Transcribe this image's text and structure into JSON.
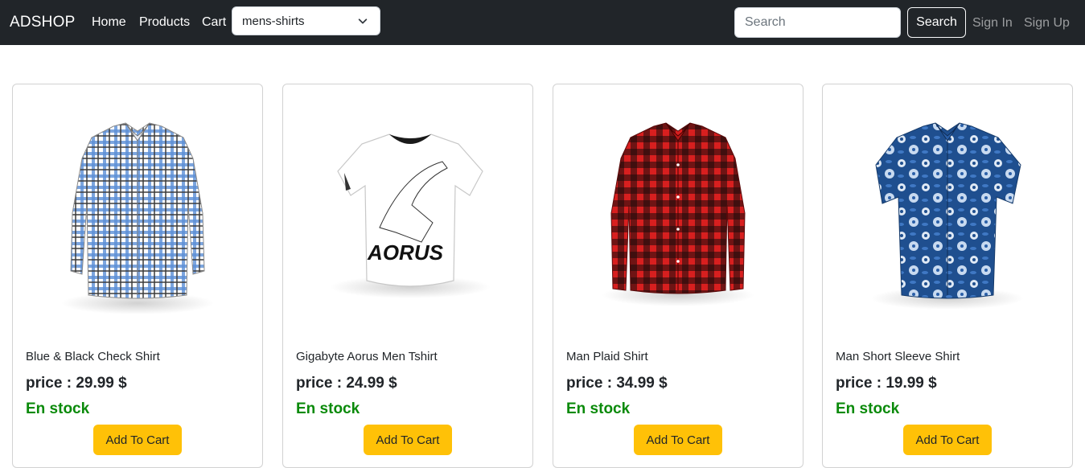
{
  "brand": "ADSHOP",
  "nav": {
    "home": "Home",
    "products": "Products",
    "cart": "Cart"
  },
  "category_select": {
    "value": "mens-shirts"
  },
  "search": {
    "placeholder": "Search",
    "button": "Search"
  },
  "auth": {
    "sign_in": "Sign In",
    "sign_up": "Sign Up"
  },
  "products": [
    {
      "title": "Blue & Black Check Shirt",
      "price_label": "price :",
      "price": "29.99",
      "currency": "$",
      "stock": "En stock",
      "button": "Add To Cart"
    },
    {
      "title": "Gigabyte Aorus Men Tshirt",
      "price_label": "price :",
      "price": "24.99",
      "currency": "$",
      "stock": "En stock",
      "button": "Add To Cart"
    },
    {
      "title": "Man Plaid Shirt",
      "price_label": "price :",
      "price": "34.99",
      "currency": "$",
      "stock": "En stock",
      "button": "Add To Cart"
    },
    {
      "title": "Man Short Sleeve Shirt",
      "price_label": "price :",
      "price": "19.99",
      "currency": "$",
      "stock": "En stock",
      "button": "Add To Cart"
    }
  ],
  "tshirt_logo_text": "AORUS",
  "colors": {
    "navbar": "#212529",
    "accent": "#ffc107",
    "in_stock": "#0a8a0a"
  }
}
